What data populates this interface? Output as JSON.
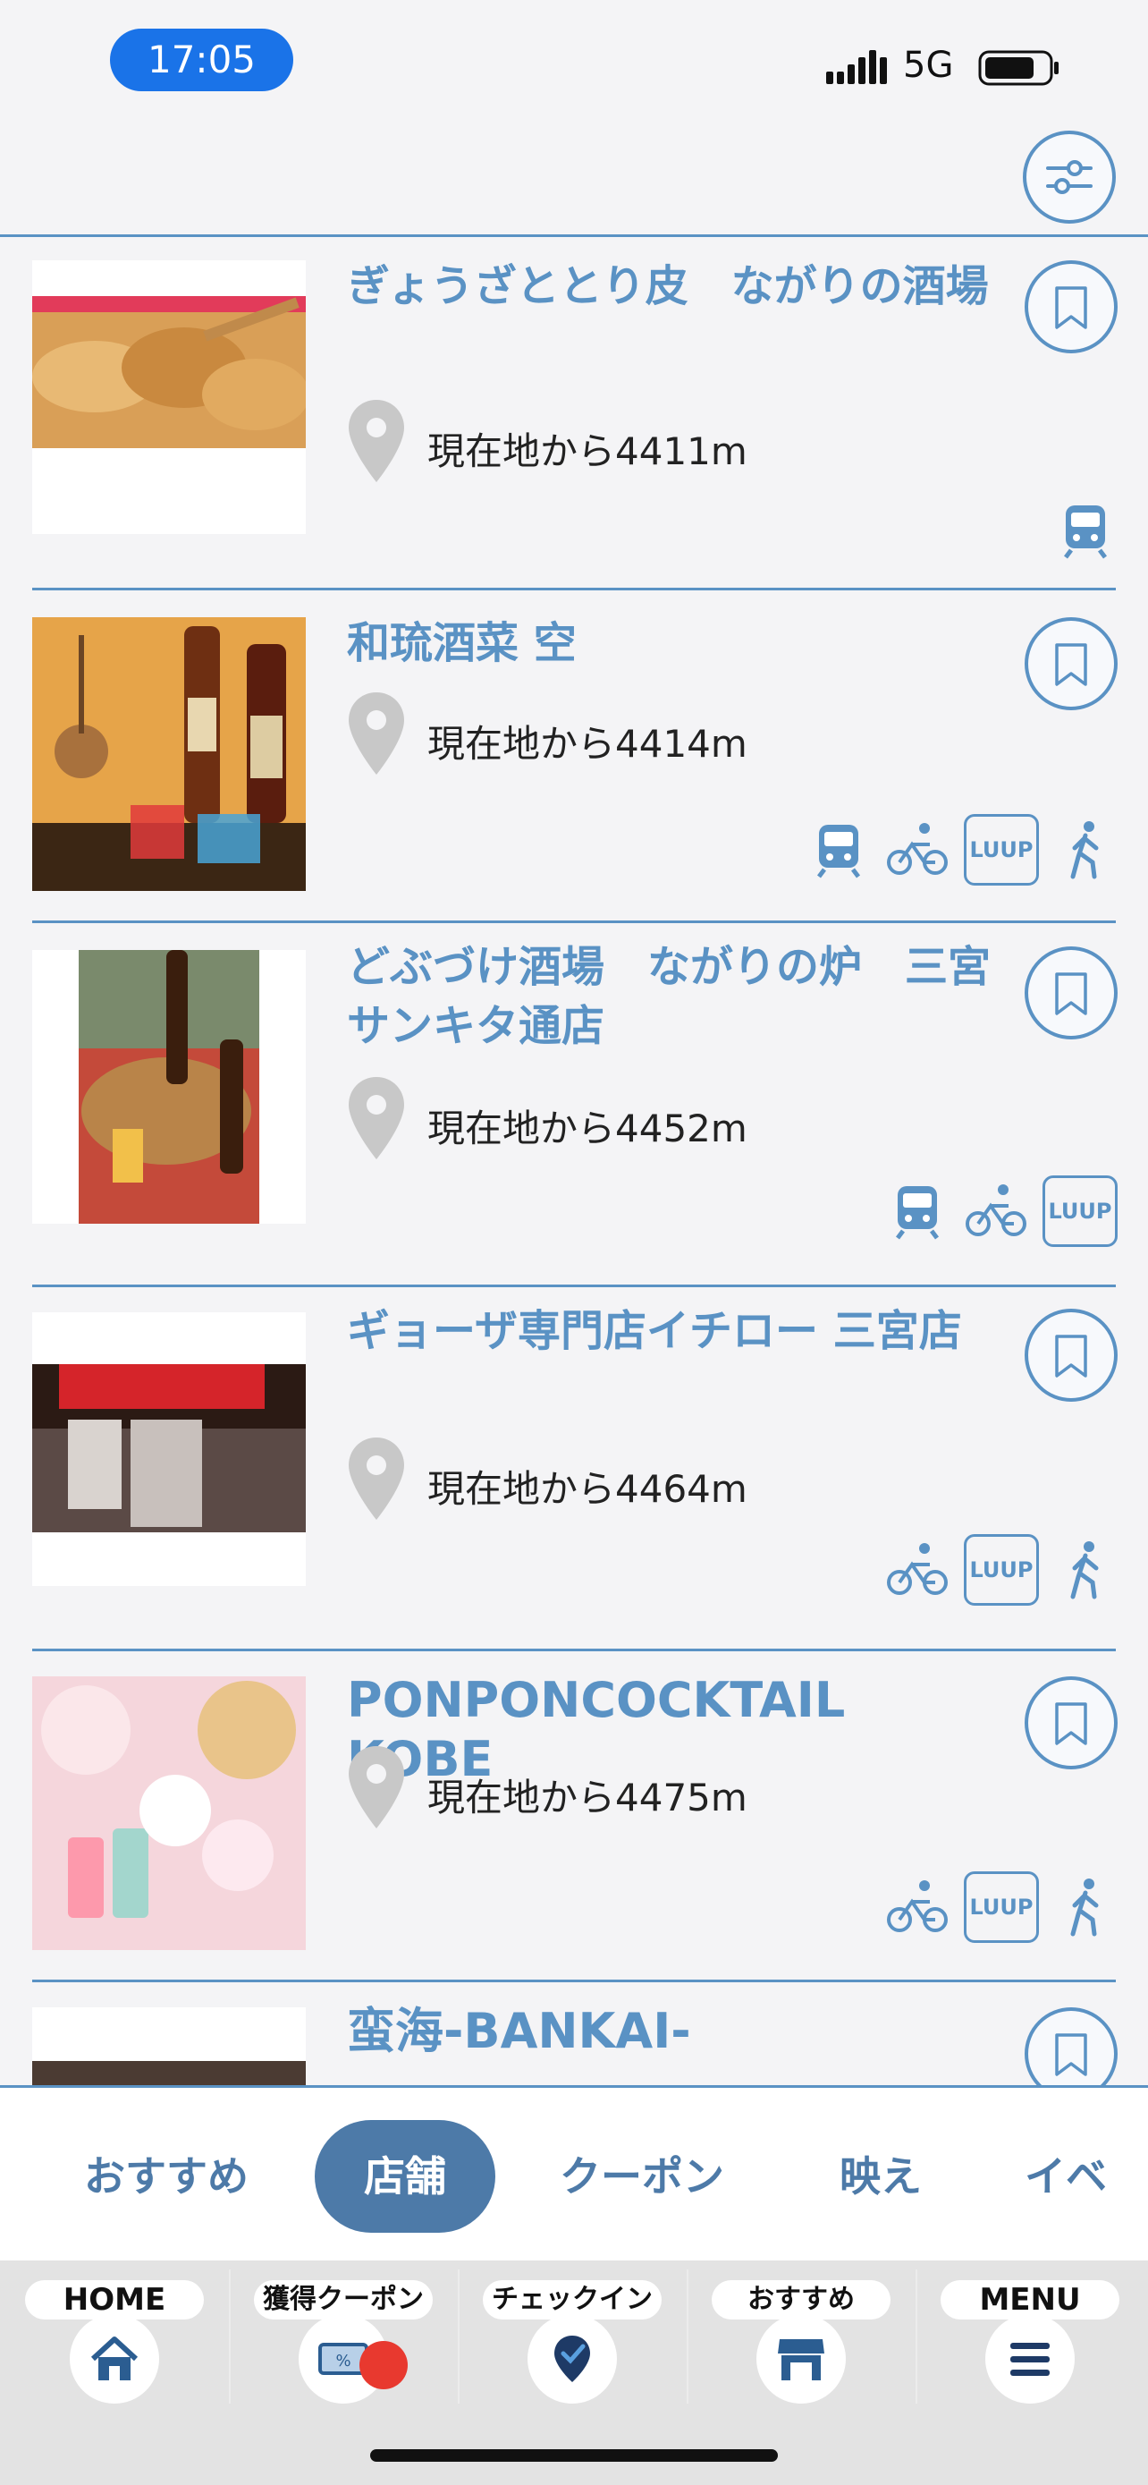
{
  "status_bar": {
    "time": "17:05",
    "network": "5G"
  },
  "shops": [
    {
      "name": "ぎょうざととり皮　ながりの酒場",
      "distance": "現在地から4411m",
      "transports": [
        "train"
      ]
    },
    {
      "name": "和琉酒菜 空",
      "distance": "現在地から4414m",
      "transports": [
        "train",
        "bicycle",
        "luup",
        "walk"
      ]
    },
    {
      "name": "どぶづけ酒場　ながりの炉　三宮サンキタ通店",
      "distance": "現在地から4452m",
      "transports": [
        "train",
        "bicycle",
        "luup"
      ]
    },
    {
      "name": "ギョーザ専門店イチロー 三宮店",
      "distance": "現在地から4464m",
      "transports": [
        "bicycle",
        "luup",
        "walk"
      ]
    },
    {
      "name": "PONPONCOCKTAIL KOBE",
      "distance": "現在地から4475m",
      "transports": [
        "bicycle",
        "luup",
        "walk"
      ]
    },
    {
      "name": "蛮海-BANKAI-",
      "distance": "",
      "transports": []
    }
  ],
  "luup_label": "LUUP",
  "category_tabs": [
    {
      "label": "おすすめ",
      "active": false
    },
    {
      "label": "店舗",
      "active": true
    },
    {
      "label": "クーポン",
      "active": false
    },
    {
      "label": "映え",
      "active": false
    },
    {
      "label": "イベ",
      "active": false
    }
  ],
  "bottom_nav": [
    {
      "label": "HOME",
      "icon": "home-icon"
    },
    {
      "label": "獲得クーポン",
      "icon": "coupon-icon"
    },
    {
      "label": "チェックイン",
      "icon": "checkin-icon"
    },
    {
      "label": "おすすめ",
      "icon": "store-icon"
    },
    {
      "label": "MENU",
      "icon": "menu-icon"
    }
  ],
  "colors": {
    "accent": "#5a92c4",
    "active_tab": "#4d7aa8",
    "time_pill": "#1a73e8",
    "badge": "#e8392f"
  }
}
